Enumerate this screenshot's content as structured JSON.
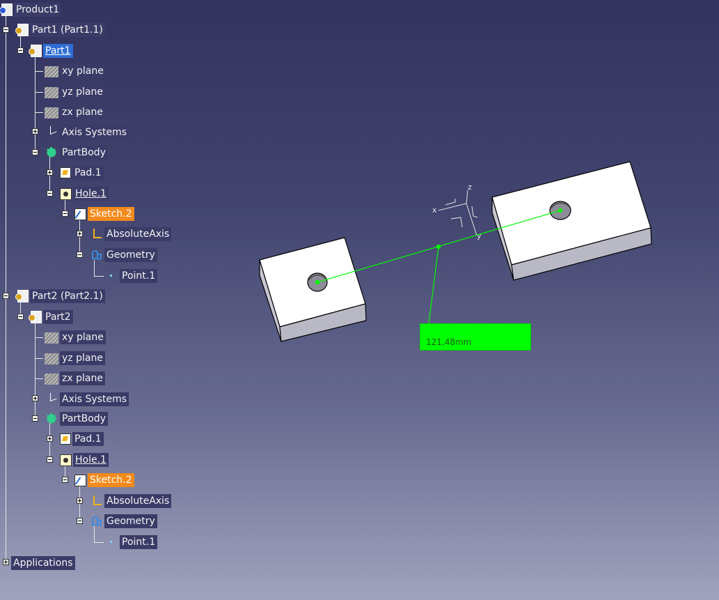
{
  "tree": {
    "root_label": "Product1",
    "part1_instance_label": "Part1 (Part1.1)",
    "part1_label": "Part1",
    "part2_instance_label": "Part2 (Part2.1)",
    "part2_label": "Part2",
    "items": {
      "xy_plane": "xy plane",
      "yz_plane": "yz plane",
      "zx_plane": "zx plane",
      "axis_systems": "Axis Systems",
      "partbody": "PartBody",
      "pad": "Pad.1",
      "hole": "Hole.1",
      "sketch": "Sketch.2",
      "absolute_axis": "AbsoluteAxis",
      "geometry": "Geometry",
      "point": "Point.1"
    },
    "applications_label": "Applications",
    "selection_color": "#2f6ed6",
    "highlight_color": "#f28a1c"
  },
  "viewport": {
    "measurement_value": "121,48mm",
    "measurement_color": "#00ff00",
    "compass_labels": {
      "x": "x",
      "y": "y",
      "z": "z"
    }
  }
}
